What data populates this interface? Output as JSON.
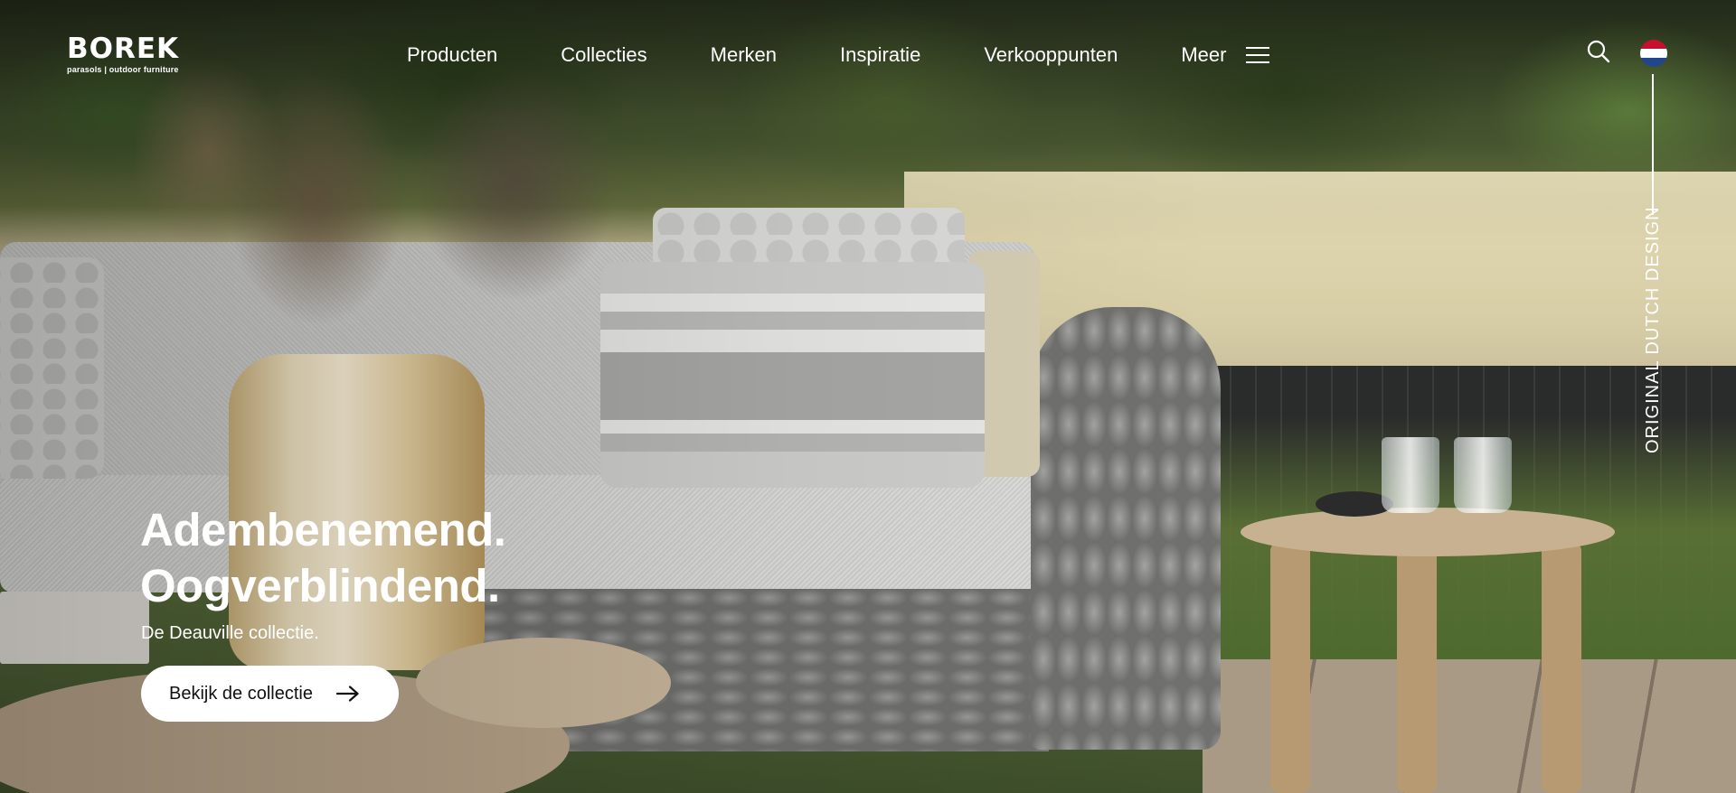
{
  "brand": {
    "name": "BOREK",
    "tagline": "parasols | outdoor furniture"
  },
  "nav": {
    "items": [
      "Producten",
      "Collecties",
      "Merken",
      "Inspiratie",
      "Verkooppunten"
    ],
    "more_label": "Meer"
  },
  "header": {
    "search_icon": "search-icon",
    "language_flag": "dutch-flag-icon"
  },
  "side_text": "ORIGINAL DUTCH DESIGN",
  "hero": {
    "headline_line1": "Adembenemend.",
    "headline_line2": "Oogverblindend.",
    "subline": "De Deauville collectie.",
    "cta_label": "Bekijk de collectie",
    "cta_icon": "arrow-right-icon"
  },
  "colors": {
    "text": "#ffffff",
    "button_bg": "#ffffff",
    "button_text": "#111111",
    "flag_red": "#c8102e",
    "flag_white": "#ffffff",
    "flag_blue": "#21468b"
  }
}
